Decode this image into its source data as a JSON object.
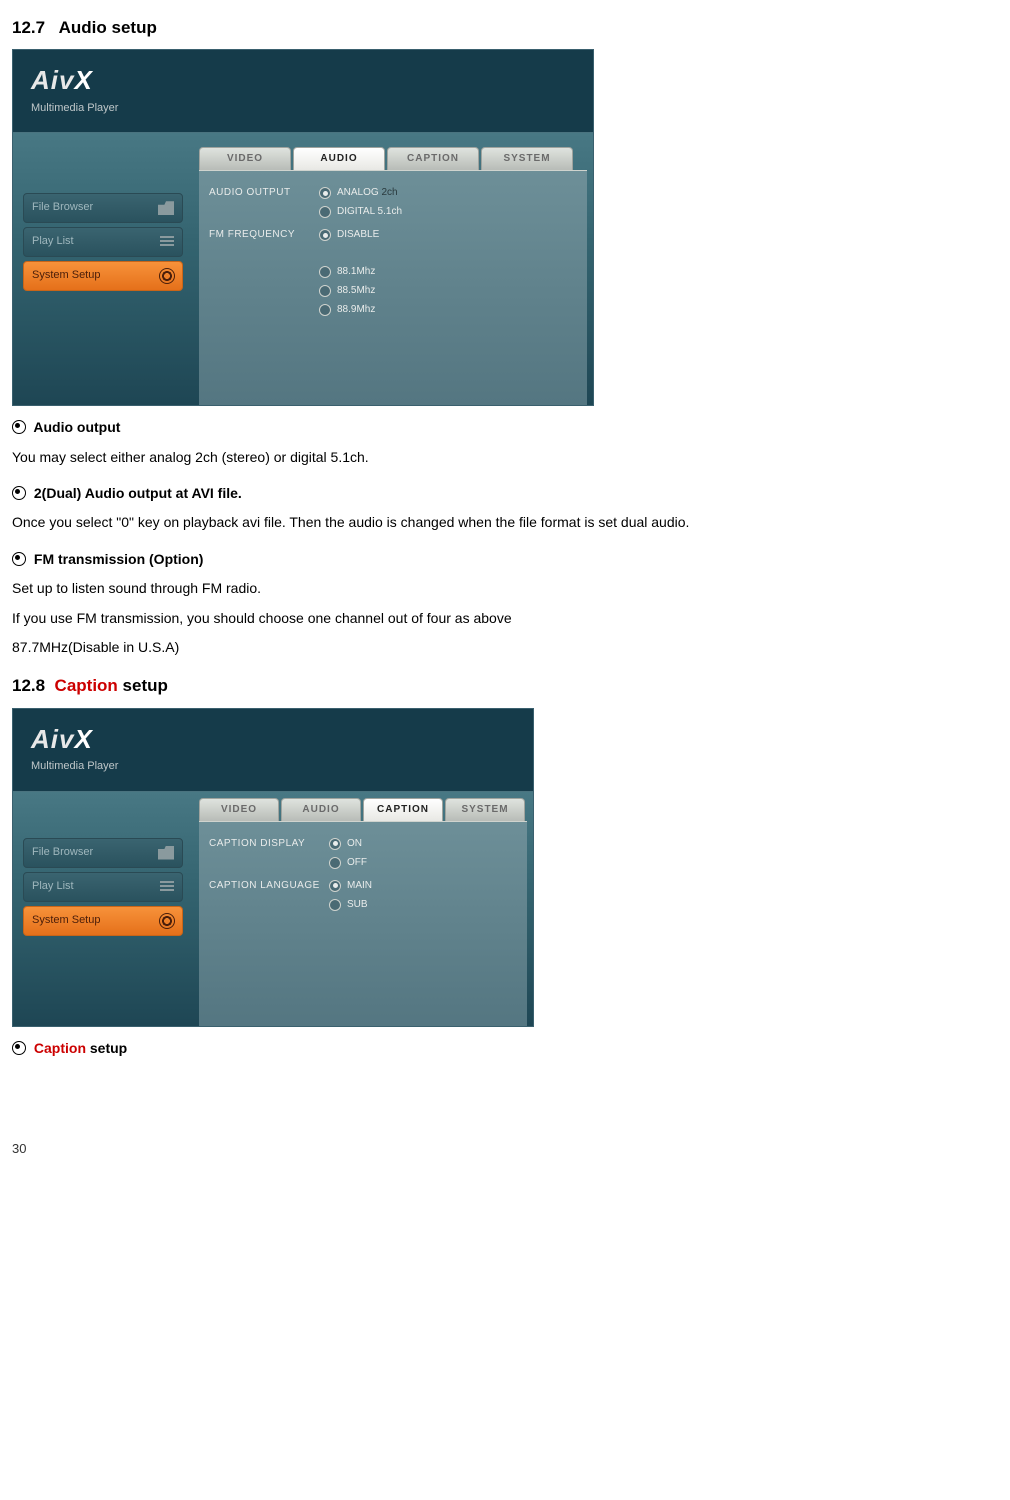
{
  "doc": {
    "section_audio_num": "12.7",
    "section_audio_title": "Audio setup",
    "section_caption_num": "12.8",
    "section_caption_word": "Caption",
    "section_caption_rest": " setup",
    "page_number": "30"
  },
  "app": {
    "logo_main": "Aiv",
    "logo_x": "X",
    "logo_sub": "Multimedia Player",
    "sidebar": {
      "file_browser": "File Browser",
      "play_list": "Play List",
      "system_setup": "System Setup"
    },
    "tabs": {
      "video": "VIDEO",
      "audio": "AUDIO",
      "caption": "CAPTION",
      "system": "SYSTEM"
    },
    "audio_panel": {
      "label_output": "AUDIO OUTPUT",
      "opt_analog": "ANALOG",
      "opt_analog_suffix": "2ch",
      "opt_digital": "DIGITAL 5.1ch",
      "label_fm": "FM FREQUENCY",
      "opt_disable": "DISABLE",
      "opt_881": "88.1Mhz",
      "opt_885": "88.5Mhz",
      "opt_889": "88.9Mhz"
    },
    "caption_panel": {
      "label_display": "CAPTION DISPLAY",
      "opt_on": "ON",
      "opt_off": "OFF",
      "label_lang": "CAPTION LANGUAGE",
      "opt_main": "MAIN",
      "opt_sub": "SUB"
    }
  },
  "text": {
    "h_audio_output": "Audio output",
    "p_audio_output": "You may select either analog 2ch (stereo) or digital 5.1ch.",
    "h_dual": "2(Dual) Audio output at AVI file.",
    "p_dual": "Once you select \"0\" key on playback avi file. Then the audio is changed when the file format is set dual audio.",
    "h_fm": "FM transmission (Option)",
    "p_fm1": "Set up to listen sound through FM radio.",
    "p_fm2": "If you use FM transmission, you should choose one channel out of four as above",
    "p_fm3": "87.7MHz(Disable in U.S.A)",
    "h_caption_word": "Caption",
    "h_caption_rest": " setup"
  }
}
